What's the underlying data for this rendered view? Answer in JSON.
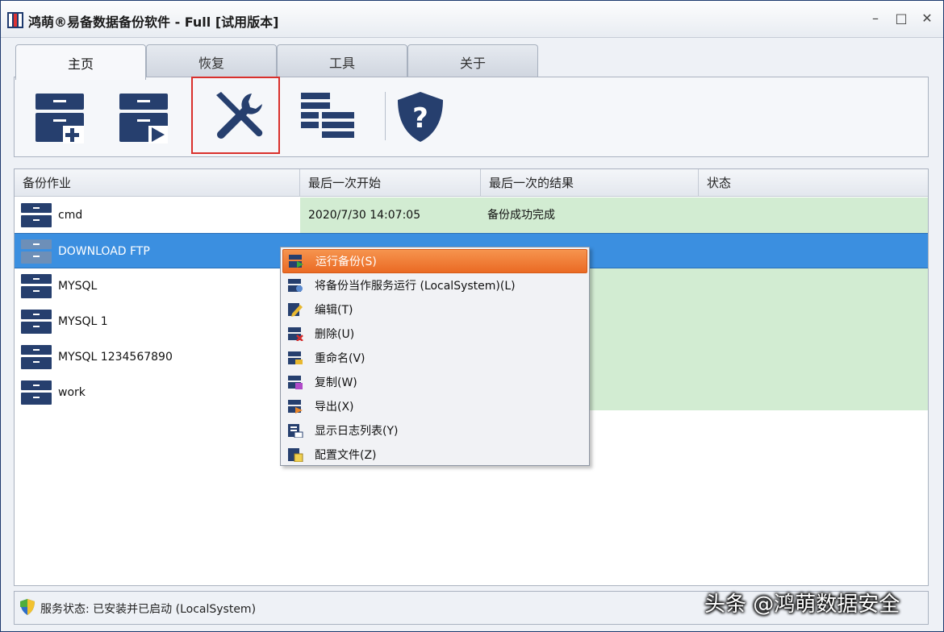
{
  "window": {
    "title": "鸿萌®易备数据备份软件 - Full [试用版本]",
    "minimize": "–",
    "maximize": "□",
    "close": "✕"
  },
  "tabs": [
    {
      "label": "主页",
      "active": true
    },
    {
      "label": "恢复",
      "active": false
    },
    {
      "label": "工具",
      "active": false
    },
    {
      "label": "关于",
      "active": false
    }
  ],
  "ribbon": {
    "buttons": [
      "new-backup-icon",
      "run-backup-icon",
      "tools-icon",
      "log-list-icon",
      "help-shield-icon"
    ]
  },
  "table": {
    "columns": [
      "备份作业",
      "最后一次开始",
      "最后一次的结果",
      "状态"
    ],
    "rows": [
      {
        "name": "cmd",
        "last_start": "2020/7/30 14:07:05",
        "last_result": "备份成功完成",
        "status": ""
      },
      {
        "name": "DOWNLOAD FTP",
        "last_start": "",
        "last_result": "",
        "status": ""
      },
      {
        "name": "MYSQL",
        "last_start": "",
        "last_result": "",
        "status": ""
      },
      {
        "name": "MYSQL 1",
        "last_start": "",
        "last_result": "",
        "status": ""
      },
      {
        "name": "MYSQL 1234567890",
        "last_start": "",
        "last_result": "",
        "status": ""
      },
      {
        "name": "work",
        "last_start": "",
        "last_result": "",
        "status": ""
      }
    ]
  },
  "context_menu": {
    "items": [
      {
        "label": "运行备份(S)",
        "icon": "run-icon"
      },
      {
        "label": "将备份当作服务运行 (LocalSystem)(L)",
        "icon": "service-icon"
      },
      {
        "label": "编辑(T)",
        "icon": "edit-icon"
      },
      {
        "label": "删除(U)",
        "icon": "delete-icon"
      },
      {
        "label": "重命名(V)",
        "icon": "rename-icon"
      },
      {
        "label": "复制(W)",
        "icon": "copy-icon"
      },
      {
        "label": "导出(X)",
        "icon": "export-icon"
      },
      {
        "label": "显示日志列表(Y)",
        "icon": "log-icon"
      },
      {
        "label": "配置文件(Z)",
        "icon": "config-icon"
      }
    ]
  },
  "statusbar": {
    "text": "服务状态: 已安装并已启动 (LocalSystem)"
  },
  "watermark": "头条 @鸿萌数据安全",
  "colors": {
    "navy": "#1e3a6e",
    "selected_row": "#3b8fe0",
    "result_green": "#d2ecd2",
    "menu_hover": "#ea6a24",
    "highlight_box": "#d9302c"
  }
}
